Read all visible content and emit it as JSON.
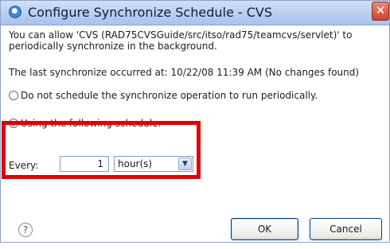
{
  "window": {
    "title": "Configure Synchronize Schedule - CVS",
    "close_glyph": "✕"
  },
  "content": {
    "description_line1": "You can allow 'CVS (RAD75CVSGuide/src/itso/rad75/teamcvs/servlet)' to",
    "description_line2": "periodically synchronize in the background.",
    "last_sync": "The last synchronize occurred at: 10/22/08 11:39 AM (No changes found)",
    "option_none": "Do not schedule the synchronize operation to run periodically.",
    "option_schedule": "Using the following schedule:",
    "option_schedule_selected": true
  },
  "schedule": {
    "every_label": "Every:",
    "every_value": "1",
    "unit_value": "hour(s)"
  },
  "footer": {
    "help_glyph": "?",
    "ok_label": "OK",
    "cancel_label": "Cancel"
  },
  "colors": {
    "highlight": "#e00000",
    "title_bar": "#b6cdef",
    "close_button": "#c9442b"
  },
  "icons": {
    "title": "synchronize-icon",
    "close": "close-icon",
    "help": "help-icon",
    "dropdown": "chevron-down-icon"
  }
}
